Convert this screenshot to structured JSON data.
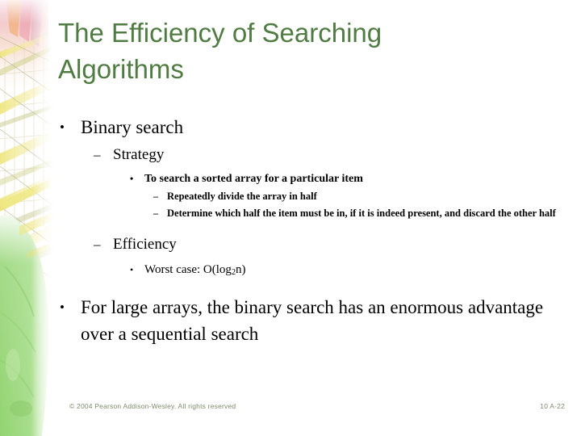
{
  "slide": {
    "title": "The Efficiency of Searching Algorithms",
    "title_line1": "The Efficiency of Searching",
    "title_line2": "Algorithms",
    "title_color": "#507c43",
    "background_color": "#ffffff",
    "body_text_color": "#000000"
  },
  "bullets": {
    "binary_search": {
      "marker": "•",
      "text": "Binary search"
    },
    "strategy": {
      "marker": "–",
      "text": "Strategy"
    },
    "to_search": {
      "marker": "•",
      "text": "To search a sorted array for a particular item"
    },
    "repeatedly_divide": {
      "marker": "–",
      "text": "Repeatedly divide the array in half"
    },
    "determine_half": {
      "marker": "–",
      "text": "Determine which half the item must be in, if it is indeed present, and discard the other half"
    },
    "efficiency": {
      "marker": "–",
      "text": "Efficiency"
    },
    "worst_case": {
      "marker": "•",
      "text_before_sub": "Worst case: O(log",
      "sub": "2",
      "text_after_sub": "n)"
    },
    "large_arrays": {
      "marker": "•",
      "text": "For large arrays, the binary search has an enormous advantage over a sequential search"
    }
  },
  "footer": {
    "copyright": "© 2004 Pearson Addison-Wesley. All rights reserved",
    "page_number": "10 A-22",
    "color": "#7d8b6d"
  },
  "decoration": {
    "name": "left-border-artwork",
    "description": "faded scaffolding lattice over pale pink at top, light green foliage blob at bottom",
    "green": "#9fd880",
    "yellow": "#e8e07a",
    "pink": "#f0b8c8",
    "orange": "#f0a85e",
    "lattice": "#d9d3b0"
  }
}
